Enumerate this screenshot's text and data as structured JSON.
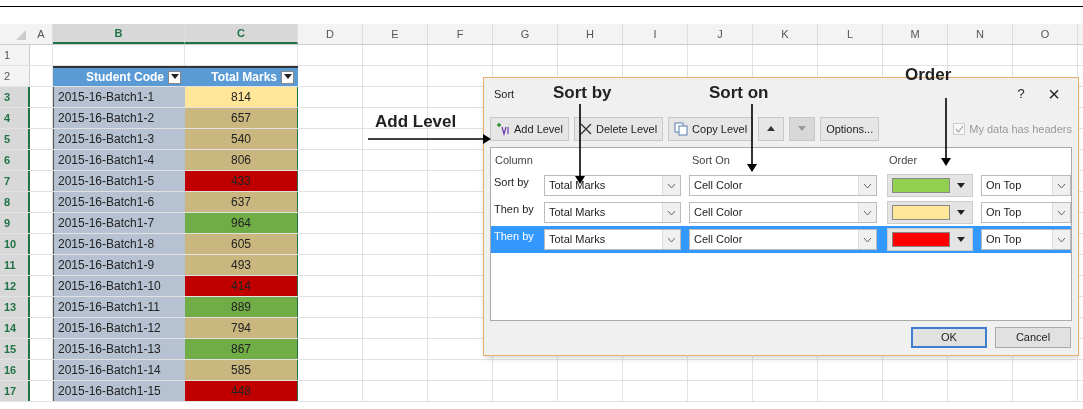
{
  "sheet": {
    "columns": [
      {
        "label": "A",
        "selected": false
      },
      {
        "label": "B",
        "selected": true
      },
      {
        "label": "C",
        "selected": true
      },
      {
        "label": "D",
        "selected": false
      },
      {
        "label": "E",
        "selected": false
      },
      {
        "label": "F",
        "selected": false
      },
      {
        "label": "G",
        "selected": false
      },
      {
        "label": "H",
        "selected": false
      },
      {
        "label": "I",
        "selected": false
      },
      {
        "label": "J",
        "selected": false
      },
      {
        "label": "K",
        "selected": false
      },
      {
        "label": "L",
        "selected": false
      },
      {
        "label": "M",
        "selected": false
      },
      {
        "label": "N",
        "selected": false
      },
      {
        "label": "O",
        "selected": false
      }
    ],
    "rows": [
      {
        "number": "1",
        "selected": false,
        "kind": "empty"
      },
      {
        "number": "2",
        "selected": false,
        "kind": "header",
        "cells": [
          "Student Code",
          "Total Marks"
        ]
      },
      {
        "number": "3",
        "selected": true,
        "kind": "data",
        "cells": [
          "2015-16-Batch1-1",
          "814"
        ],
        "color": "#ffe699"
      },
      {
        "number": "4",
        "selected": true,
        "kind": "data",
        "cells": [
          "2015-16-Batch1-2",
          "657"
        ],
        "color": "#c9b77f"
      },
      {
        "number": "5",
        "selected": true,
        "kind": "data",
        "cells": [
          "2015-16-Batch1-3",
          "540"
        ],
        "color": "#c9b77f"
      },
      {
        "number": "6",
        "selected": true,
        "kind": "data",
        "cells": [
          "2015-16-Batch1-4",
          "806"
        ],
        "color": "#c9b77f"
      },
      {
        "number": "7",
        "selected": true,
        "kind": "data",
        "cells": [
          "2015-16-Batch1-5",
          "433"
        ],
        "color": "#c00000"
      },
      {
        "number": "8",
        "selected": true,
        "kind": "data",
        "cells": [
          "2015-16-Batch1-6",
          "637"
        ],
        "color": "#c9b77f"
      },
      {
        "number": "9",
        "selected": true,
        "kind": "data",
        "cells": [
          "2015-16-Batch1-7",
          "964"
        ],
        "color": "#70ad47"
      },
      {
        "number": "10",
        "selected": true,
        "kind": "data",
        "cells": [
          "2015-16-Batch1-8",
          "605"
        ],
        "color": "#c9b77f"
      },
      {
        "number": "11",
        "selected": true,
        "kind": "data",
        "cells": [
          "2015-16-Batch1-9",
          "493"
        ],
        "color": "#c9b77f"
      },
      {
        "number": "12",
        "selected": true,
        "kind": "data",
        "cells": [
          "2015-16-Batch1-10",
          "414"
        ],
        "color": "#c00000"
      },
      {
        "number": "13",
        "selected": true,
        "kind": "data",
        "cells": [
          "2015-16-Batch1-11",
          "889"
        ],
        "color": "#70ad47"
      },
      {
        "number": "14",
        "selected": true,
        "kind": "data",
        "cells": [
          "2015-16-Batch1-12",
          "794"
        ],
        "color": "#c9b77f"
      },
      {
        "number": "15",
        "selected": true,
        "kind": "data",
        "cells": [
          "2015-16-Batch1-13",
          "867"
        ],
        "color": "#70ad47"
      },
      {
        "number": "16",
        "selected": true,
        "kind": "data",
        "cells": [
          "2015-16-Batch1-14",
          "585"
        ],
        "color": "#c9b77f"
      },
      {
        "number": "17",
        "selected": true,
        "kind": "data",
        "cells": [
          "2015-16-Batch1-15",
          "448"
        ],
        "color": "#c00000"
      }
    ]
  },
  "dialog": {
    "title": "Sort",
    "help": "?",
    "close": "×",
    "toolbar": [
      {
        "kind": "add",
        "label": "Add Level",
        "disabled": false
      },
      {
        "kind": "delete",
        "label": "Delete Level",
        "disabled": false
      },
      {
        "kind": "copy",
        "label": "Copy Level",
        "disabled": false
      },
      {
        "kind": "up",
        "disabled": false
      },
      {
        "kind": "down",
        "disabled": true
      },
      {
        "kind": "options",
        "label": "Options...",
        "disabled": false
      }
    ],
    "headers_checkbox": {
      "label": "My data has headers",
      "checked": true,
      "disabled": true
    },
    "columns": [
      "Column",
      "Sort On",
      "Order"
    ],
    "levels": [
      {
        "label": "Sort by",
        "column": "Total Marks",
        "sort_on": "Cell Color",
        "color": "#92d050",
        "position": "On Top",
        "selected": false
      },
      {
        "label": "Then by",
        "column": "Total Marks",
        "sort_on": "Cell Color",
        "color": "#ffe699",
        "position": "On Top",
        "selected": false
      },
      {
        "label": "Then by",
        "column": "Total Marks",
        "sort_on": "Cell Color",
        "color": "#ff0000",
        "position": "On Top",
        "selected": true
      }
    ],
    "buttons": [
      "OK",
      "Cancel"
    ]
  },
  "annotations": [
    "Add Level",
    "Sort by",
    "Sort on",
    "Order"
  ]
}
